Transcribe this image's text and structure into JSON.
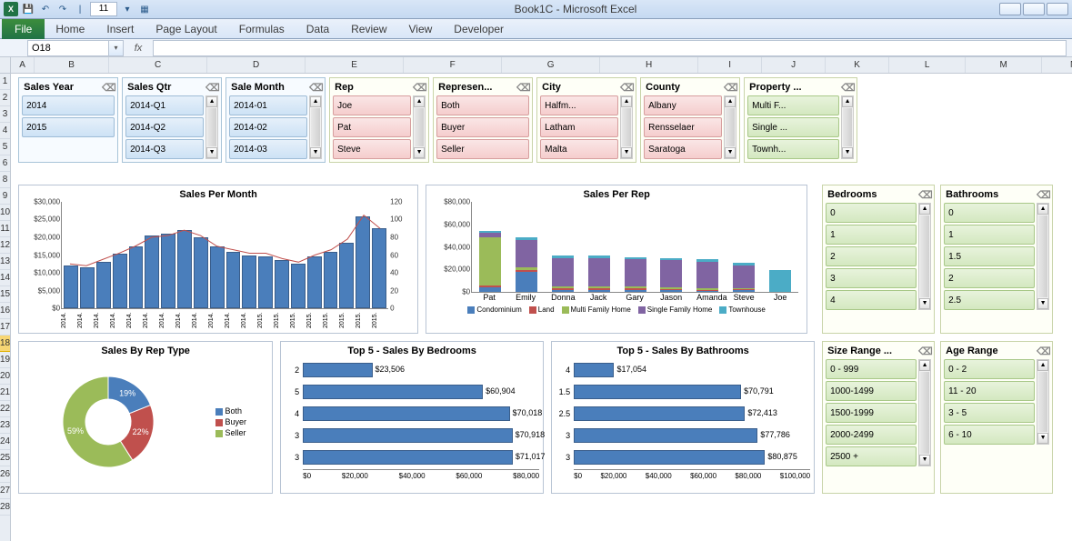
{
  "titlebar": {
    "title": "Book1C - Microsoft Excel",
    "qat_number": "11"
  },
  "ribbon": {
    "file": "File",
    "tabs": [
      "Home",
      "Insert",
      "Page Layout",
      "Formulas",
      "Data",
      "Review",
      "View",
      "Developer"
    ]
  },
  "namebox": "O18",
  "columns": [
    {
      "l": "A",
      "w": 26
    },
    {
      "l": "B",
      "w": 82
    },
    {
      "l": "C",
      "w": 108
    },
    {
      "l": "D",
      "w": 108
    },
    {
      "l": "E",
      "w": 108
    },
    {
      "l": "F",
      "w": 108
    },
    {
      "l": "G",
      "w": 108
    },
    {
      "l": "H",
      "w": 108
    },
    {
      "l": "I",
      "w": 70
    },
    {
      "l": "J",
      "w": 70
    },
    {
      "l": "K",
      "w": 70
    },
    {
      "l": "L",
      "w": 84
    },
    {
      "l": "M",
      "w": 84
    },
    {
      "l": "N",
      "w": 70
    }
  ],
  "rows": [
    "1",
    "2",
    "3",
    "4",
    "5",
    "6",
    "8",
    "9",
    "10",
    "11",
    "12",
    "13",
    "14",
    "15",
    "16",
    "17",
    "18",
    "19",
    "20",
    "21",
    "22",
    "23",
    "24",
    "25",
    "26",
    "27",
    "28"
  ],
  "sel_row": "18",
  "slicers_top": [
    {
      "title": "Sales Year",
      "color": "blue",
      "items": [
        "2014",
        "2015"
      ],
      "scroll": false
    },
    {
      "title": "Sales Qtr",
      "color": "blue",
      "items": [
        "2014-Q1",
        "2014-Q2",
        "2014-Q3"
      ],
      "scroll": true
    },
    {
      "title": "Sale Month",
      "color": "blue",
      "items": [
        "2014-01",
        "2014-02",
        "2014-03"
      ],
      "scroll": true
    },
    {
      "title": "Rep",
      "color": "red",
      "items": [
        "Joe",
        "Pat",
        "Steve"
      ],
      "scroll": true
    },
    {
      "title": "Represen...",
      "color": "red",
      "items": [
        "Both",
        "Buyer",
        "Seller"
      ],
      "scroll": false
    },
    {
      "title": "City",
      "color": "red",
      "items": [
        "Halfm...",
        "Latham",
        "Malta"
      ],
      "scroll": true
    },
    {
      "title": "County",
      "color": "red",
      "items": [
        "Albany",
        "Rensselaer",
        "Saratoga"
      ],
      "scroll": true
    },
    {
      "title": "Property ...",
      "color": "green",
      "items": [
        "Multi F...",
        "Single ...",
        "Townh..."
      ],
      "scroll": true
    }
  ],
  "slicers_right1": [
    {
      "title": "Bedrooms",
      "items": [
        "0",
        "1",
        "2",
        "3",
        "4"
      ]
    },
    {
      "title": "Bathrooms",
      "items": [
        "0",
        "1",
        "1.5",
        "2",
        "2.5"
      ]
    }
  ],
  "slicers_right2": [
    {
      "title": "Size Range ...",
      "items": [
        "0 - 999",
        "1000-1499",
        "1500-1999",
        "2000-2499",
        "2500 +"
      ]
    },
    {
      "title": "Age Range",
      "items": [
        "0 - 2",
        "11 - 20",
        "3 - 5",
        "6 - 10"
      ]
    }
  ],
  "chart_data": [
    {
      "id": "sales_per_month",
      "type": "bar+line",
      "title": "Sales Per Month",
      "y1_ticks": [
        "$0",
        "$5,000",
        "$10,000",
        "$15,000",
        "$20,000",
        "$25,000",
        "$30,000"
      ],
      "y2_ticks": [
        "0",
        "20",
        "40",
        "60",
        "80",
        "100",
        "120"
      ],
      "ylim": [
        0,
        30000
      ],
      "y2lim": [
        0,
        120
      ],
      "categories": [
        "2014.",
        "2014.",
        "2014.",
        "2014.",
        "2014.",
        "2014.",
        "2014.",
        "2014.",
        "2014.",
        "2014.",
        "2014.",
        "2014.",
        "2015.",
        "2015.",
        "2015.",
        "2015.",
        "2015.",
        "2015.",
        "2015.",
        "2015."
      ],
      "bars": [
        12000,
        11500,
        13000,
        15500,
        17500,
        20500,
        21000,
        22000,
        20000,
        17500,
        16000,
        15000,
        14500,
        13500,
        12500,
        14500,
        16000,
        18500,
        26000,
        22500
      ],
      "line": [
        50,
        48,
        55,
        62,
        70,
        80,
        82,
        88,
        82,
        70,
        66,
        62,
        62,
        56,
        52,
        60,
        66,
        78,
        105,
        90
      ]
    },
    {
      "id": "sales_per_rep",
      "type": "stacked-bar",
      "title": "Sales Per Rep",
      "ylim": [
        0,
        80000
      ],
      "y_ticks": [
        "$0",
        "$20,000",
        "$40,000",
        "$60,000",
        "$80,000"
      ],
      "categories": [
        "Pat",
        "Emily",
        "Donna",
        "Jack",
        "Gary",
        "Jason",
        "Amanda",
        "Steve",
        "Joe"
      ],
      "series": [
        {
          "name": "Condominium",
          "color": "#4a7ebb",
          "values": [
            4000,
            18000,
            2000,
            1500,
            2000,
            1500,
            1000,
            1500,
            0
          ]
        },
        {
          "name": "Land",
          "color": "#c0504d",
          "values": [
            2000,
            1000,
            1000,
            1500,
            1000,
            1000,
            1000,
            1000,
            0
          ]
        },
        {
          "name": "Multi Family Home",
          "color": "#9bbb59",
          "values": [
            42000,
            3000,
            2000,
            2000,
            1500,
            1500,
            1500,
            1000,
            0
          ]
        },
        {
          "name": "Single Family Home",
          "color": "#8064a2",
          "values": [
            4000,
            24000,
            25000,
            25000,
            24000,
            24000,
            23000,
            20000,
            0
          ]
        },
        {
          "name": "Townhouse",
          "color": "#4bacc6",
          "values": [
            2000,
            2000,
            2000,
            2000,
            2000,
            2000,
            2000,
            2000,
            19000
          ]
        }
      ]
    },
    {
      "id": "sales_by_rep_type",
      "type": "donut",
      "title": "Sales By Rep Type",
      "series": [
        {
          "name": "Both",
          "color": "#4a7ebb",
          "value": 19
        },
        {
          "name": "Buyer",
          "color": "#c0504d",
          "value": 22
        },
        {
          "name": "Seller",
          "color": "#9bbb59",
          "value": 59
        }
      ]
    },
    {
      "id": "top5_bedrooms",
      "type": "hbar",
      "title": "Top 5 - Sales By Bedrooms",
      "xlim": [
        0,
        80000
      ],
      "x_ticks": [
        "$0",
        "$20,000",
        "$40,000",
        "$60,000",
        "$80,000"
      ],
      "categories": [
        "2",
        "5",
        "4",
        "3",
        "3"
      ],
      "values": [
        23506,
        60904,
        70018,
        70918,
        71017
      ],
      "labels": [
        "$23,506",
        "$60,904",
        "$70,018",
        "$70,918",
        "$71,017"
      ]
    },
    {
      "id": "top5_bathrooms",
      "type": "hbar",
      "title": "Top 5 - Sales By Bathrooms",
      "xlim": [
        0,
        100000
      ],
      "x_ticks": [
        "$0",
        "$20,000",
        "$40,000",
        "$60,000",
        "$80,000",
        "$100,000"
      ],
      "categories": [
        "4",
        "1.5",
        "2.5",
        "3",
        "3"
      ],
      "values": [
        17054,
        70791,
        72413,
        77786,
        80875
      ],
      "labels": [
        "$17,054",
        "$70,791",
        "$72,413",
        "$77,786",
        "$80,875"
      ]
    }
  ]
}
